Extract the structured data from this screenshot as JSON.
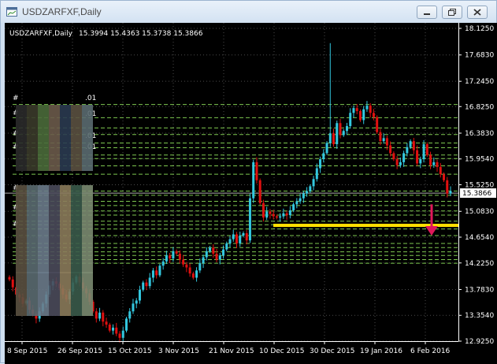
{
  "window": {
    "title": "USDZARFXF,Daily",
    "controls": [
      "minimize",
      "maximize",
      "close"
    ]
  },
  "chart_header": {
    "symbol_period": "USDZARFXF,Daily",
    "ohlc": "15.3994 15.4363 15.3738 15.3866"
  },
  "colors": {
    "background": "#000000",
    "bull": "#33c8e0",
    "bear": "#e01010",
    "grid": "#4a4a4a",
    "levels": "#7ec850",
    "support_line": "#ffe000",
    "arrow": "#e0185a"
  },
  "left_labels": [
    "#",
    ".01",
    "#",
    ".01",
    "#",
    ".01",
    "#",
    ".01",
    "#",
    "#",
    "#"
  ],
  "chart_data": {
    "type": "candlestick",
    "symbol": "USDZARFXF",
    "timeframe": "Daily",
    "current_price": 15.3866,
    "y_ticks": [
      18.125,
      17.683,
      17.245,
      16.825,
      16.383,
      15.954,
      15.525,
      15.083,
      14.654,
      14.225,
      13.783,
      13.354,
      12.925
    ],
    "y_tick_labels": [
      "18.1250",
      "17.6830",
      "17.2450",
      "16.8250",
      "16.3830",
      "15.9540",
      "15.5250",
      "15.0830",
      "14.6540",
      "14.2250",
      "13.7830",
      "13.3540",
      "12.9250"
    ],
    "ylim": [
      12.925,
      18.125
    ],
    "x_tick_labels": [
      "8 Sep 2015",
      "26 Sep 2015",
      "15 Oct 2015",
      "3 Nov 2015",
      "21 Nov 2015",
      "10 Dec 2015",
      "30 Dec 2015",
      "19 Jan 2016",
      "6 Feb 2016"
    ],
    "support_level": 14.85,
    "arrow": {
      "from": 15.2,
      "to": 14.68,
      "direction": "down"
    },
    "horizontal_levels": [
      16.86,
      16.64,
      16.47,
      16.36,
      16.22,
      16.14,
      16.02,
      15.96,
      15.84,
      15.7,
      15.42,
      15.35,
      15.25,
      15.18,
      15.09,
      15.02,
      14.92,
      14.86,
      14.79,
      14.68,
      14.55,
      14.48,
      14.41,
      14.35,
      14.28,
      14.22
    ],
    "closes": [
      13.95,
      13.82,
      13.7,
      13.65,
      13.55,
      13.6,
      13.45,
      13.38,
      13.3,
      13.42,
      13.55,
      13.7,
      13.85,
      13.92,
      13.88,
      13.8,
      13.7,
      13.62,
      13.75,
      13.9,
      14.0,
      13.9,
      13.8,
      13.72,
      13.58,
      13.42,
      13.3,
      13.4,
      13.25,
      13.2,
      13.1,
      13.15,
      13.05,
      12.98,
      13.1,
      13.3,
      13.42,
      13.55,
      13.6,
      13.78,
      13.9,
      13.84,
      13.98,
      14.1,
      14.02,
      14.18,
      14.25,
      14.35,
      14.3,
      14.42,
      14.38,
      14.28,
      14.2,
      14.15,
      14.05,
      13.98,
      14.1,
      14.22,
      14.32,
      14.42,
      14.48,
      14.38,
      14.28,
      14.35,
      14.45,
      14.55,
      14.62,
      14.7,
      14.55,
      14.68,
      14.72,
      14.6,
      15.3,
      15.9,
      15.6,
      15.22,
      14.98,
      15.08,
      15.04,
      15.0,
      14.98,
      15.0,
      15.05,
      15.02,
      15.1,
      15.2,
      15.25,
      15.3,
      15.38,
      15.42,
      15.5,
      15.62,
      15.8,
      15.95,
      16.05,
      16.22,
      16.38,
      16.2,
      16.55,
      16.35,
      16.42,
      16.5,
      16.72,
      16.8,
      16.75,
      16.6,
      16.78,
      16.84,
      16.72,
      16.65,
      16.4,
      16.25,
      16.3,
      16.18,
      16.05,
      15.95,
      15.85,
      15.9,
      16.05,
      16.15,
      16.25,
      16.1,
      15.88,
      15.95,
      16.2,
      16.02,
      15.85,
      15.9,
      15.82,
      15.7,
      15.6,
      15.38,
      15.42
    ]
  }
}
